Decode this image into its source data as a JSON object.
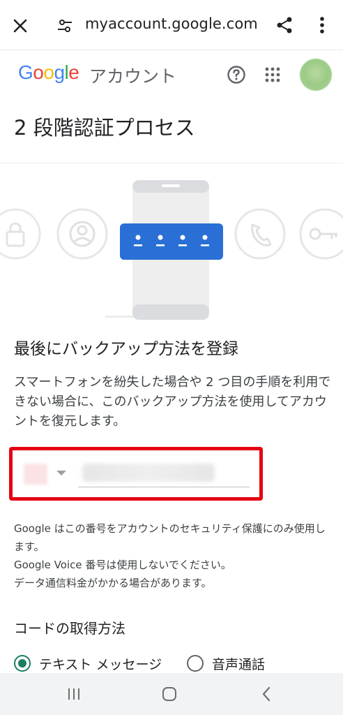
{
  "browser": {
    "url": "myaccount.google.com",
    "close_icon": "close-icon",
    "site_settings_icon": "tune-icon",
    "share_icon": "share-icon",
    "menu_icon": "more-vert-icon"
  },
  "header": {
    "logo_text": "Google",
    "product": "アカウント",
    "help_icon": "help-icon",
    "apps_icon": "apps-grid-icon",
    "logo_colors": [
      "#4285F4",
      "#EA4335",
      "#FBBC05",
      "#4285F4",
      "#34A853",
      "#EA4335"
    ]
  },
  "page": {
    "title": "2 段階認証プロセス"
  },
  "illustration": {
    "code_dots": [
      "•",
      "•",
      "•",
      "•"
    ],
    "icons": [
      "lock-icon",
      "person-icon",
      "phone-icon",
      "key-icon"
    ]
  },
  "backup": {
    "title": "最後にバックアップ方法を登録",
    "description": "スマートフォンを紛失した場合や 2 つ目の手順を利用できない場合に、このバックアップ方法を使用してアカウントを復元します。"
  },
  "phone_field": {
    "value": "",
    "highlight_color": "#e60012"
  },
  "notice": {
    "line1": "Google はこの番号をアカウントのセキュリティ保護にのみ使用します。",
    "line2": "Google Voice 番号は使用しないでください。",
    "line3": "データ通信料金がかかる場合があります。"
  },
  "code_method": {
    "title": "コードの取得方法",
    "options": [
      {
        "label": "テキスト メッセージ",
        "selected": true
      },
      {
        "label": "音声通話",
        "selected": false
      }
    ]
  },
  "nav": {
    "recents_icon": "recents-icon",
    "home_icon": "home-icon",
    "back_icon": "back-icon"
  }
}
